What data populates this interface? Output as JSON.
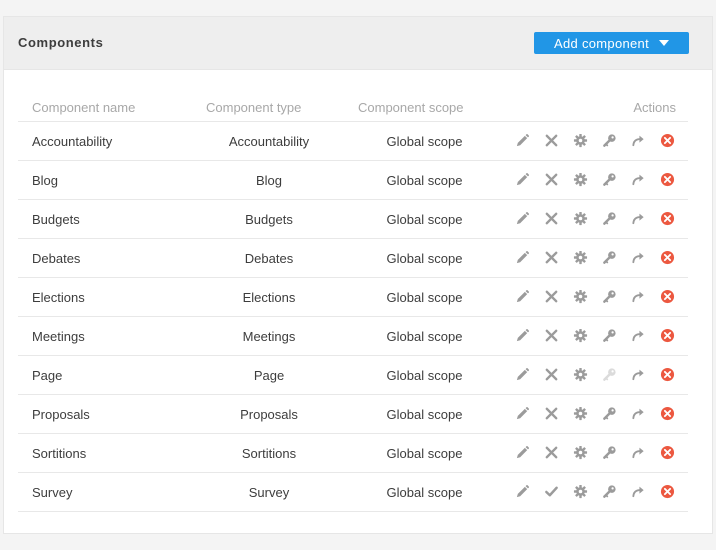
{
  "card": {
    "title": "Components"
  },
  "add_button": {
    "label": "Add component"
  },
  "table": {
    "headers": {
      "name": "Component name",
      "type": "Component type",
      "scope": "Component scope",
      "actions": "Actions"
    },
    "rows": [
      {
        "name": "Accountability",
        "type": "Accountability",
        "scope": "Global scope",
        "published": true,
        "permissions_enabled": true
      },
      {
        "name": "Blog",
        "type": "Blog",
        "scope": "Global scope",
        "published": true,
        "permissions_enabled": true
      },
      {
        "name": "Budgets",
        "type": "Budgets",
        "scope": "Global scope",
        "published": true,
        "permissions_enabled": true
      },
      {
        "name": "Debates",
        "type": "Debates",
        "scope": "Global scope",
        "published": true,
        "permissions_enabled": true
      },
      {
        "name": "Elections",
        "type": "Elections",
        "scope": "Global scope",
        "published": true,
        "permissions_enabled": true
      },
      {
        "name": "Meetings",
        "type": "Meetings",
        "scope": "Global scope",
        "published": true,
        "permissions_enabled": true
      },
      {
        "name": "Page",
        "type": "Page",
        "scope": "Global scope",
        "published": true,
        "permissions_enabled": false
      },
      {
        "name": "Proposals",
        "type": "Proposals",
        "scope": "Global scope",
        "published": true,
        "permissions_enabled": true
      },
      {
        "name": "Sortitions",
        "type": "Sortitions",
        "scope": "Global scope",
        "published": true,
        "permissions_enabled": true
      },
      {
        "name": "Survey",
        "type": "Survey",
        "scope": "Global scope",
        "published": false,
        "permissions_enabled": true
      }
    ]
  },
  "icons": {
    "configure": "pencil-icon",
    "unpublish": "x-icon",
    "publish": "check-icon",
    "settings": "gear-icon",
    "permissions": "key-icon",
    "share": "share-arrow-icon",
    "delete": "delete-circle-icon"
  },
  "colors": {
    "accent": "#2196e6",
    "icon_gray": "#9b9b9b",
    "delete_red": "#ec5840",
    "header_bg": "#eeeeee"
  }
}
